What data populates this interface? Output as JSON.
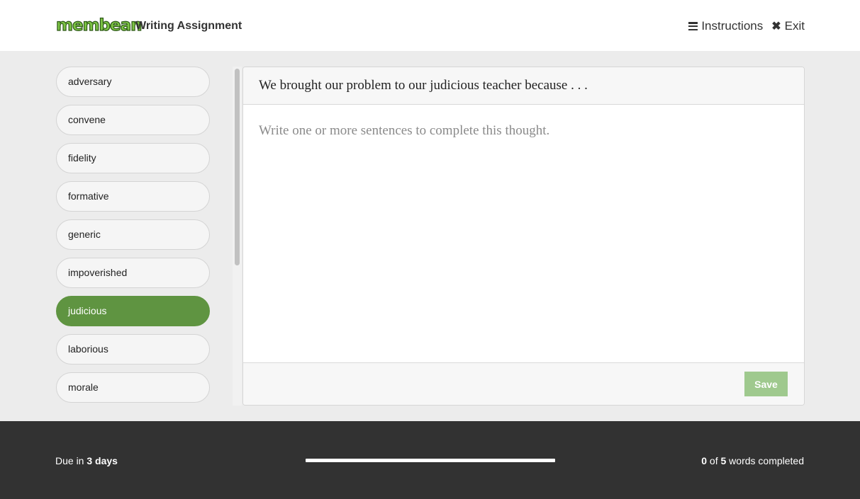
{
  "header": {
    "logo_text": "membean",
    "title": "Writing Assignment",
    "instructions_label": "Instructions",
    "exit_label": "Exit"
  },
  "word_list": [
    {
      "word": "adversary",
      "active": false
    },
    {
      "word": "convene",
      "active": false
    },
    {
      "word": "fidelity",
      "active": false
    },
    {
      "word": "formative",
      "active": false
    },
    {
      "word": "generic",
      "active": false
    },
    {
      "word": "impoverished",
      "active": false
    },
    {
      "word": "judicious",
      "active": true
    },
    {
      "word": "laborious",
      "active": false
    },
    {
      "word": "morale",
      "active": false
    }
  ],
  "editor": {
    "prompt": "We brought our problem to our judicious teacher because . . .",
    "answer_value": "",
    "answer_placeholder": "Write one or more sentences to complete this thought.",
    "save_label": "Save"
  },
  "footer": {
    "due_prefix": "Due in",
    "due_value": "3 days",
    "completed_count": "0",
    "of_label": "of",
    "total_count": "5",
    "completed_suffix": "words completed",
    "progress_fraction": 0
  },
  "colors": {
    "accent_green": "#5f9441",
    "save_disabled_green": "#9fc98e",
    "footer_bg": "#323232"
  },
  "icons": {
    "instructions": "hamburger-menu-icon",
    "exit": "close-icon"
  }
}
